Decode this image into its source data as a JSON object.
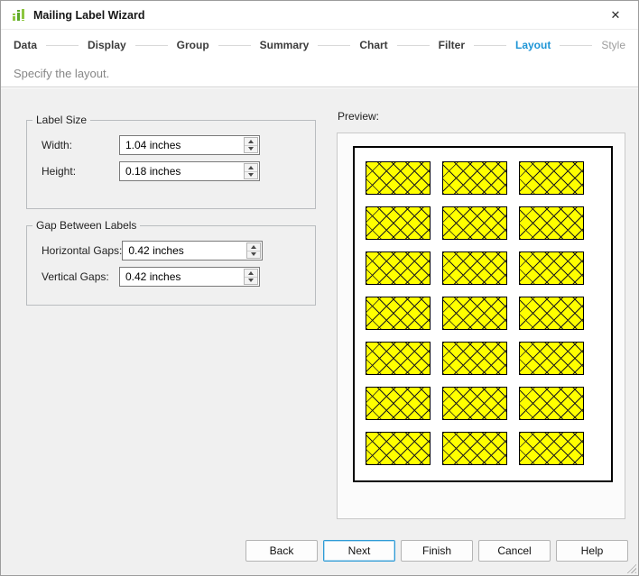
{
  "window": {
    "title": "Mailing Label Wizard",
    "close_glyph": "✕"
  },
  "nav": {
    "steps": [
      {
        "label": "Data"
      },
      {
        "label": "Display"
      },
      {
        "label": "Group"
      },
      {
        "label": "Summary"
      },
      {
        "label": "Chart"
      },
      {
        "label": "Filter"
      },
      {
        "label": "Layout"
      },
      {
        "label": "Style"
      }
    ],
    "active_step": "Layout"
  },
  "subtitle": "Specify the layout.",
  "label_size": {
    "title": "Label Size",
    "width": {
      "label": "Width:",
      "value": "1.04 inches"
    },
    "height": {
      "label": "Height:",
      "value": "0.18 inches"
    }
  },
  "gap": {
    "title": "Gap Between Labels",
    "horizontal": {
      "label": "Horizontal Gaps:",
      "value": "0.42 inches"
    },
    "vertical": {
      "label": "Vertical Gaps:",
      "value": "0.42 inches"
    }
  },
  "preview": {
    "title": "Preview:",
    "grid": {
      "rows": 7,
      "columns": 3
    },
    "label_fill": "#ffff00",
    "label_pattern": "crosshatch"
  },
  "footer": {
    "buttons": [
      {
        "label": "Back"
      },
      {
        "label": "Next",
        "default": true
      },
      {
        "label": "Finish"
      },
      {
        "label": "Cancel"
      },
      {
        "label": "Help"
      }
    ]
  },
  "colors": {
    "accent_blue": "#1e95d6",
    "label_yellow": "#ffff00",
    "icon_green_dark": "#5ba829",
    "icon_green_light": "#8dc63f",
    "body_background": "#f0f0f0"
  }
}
